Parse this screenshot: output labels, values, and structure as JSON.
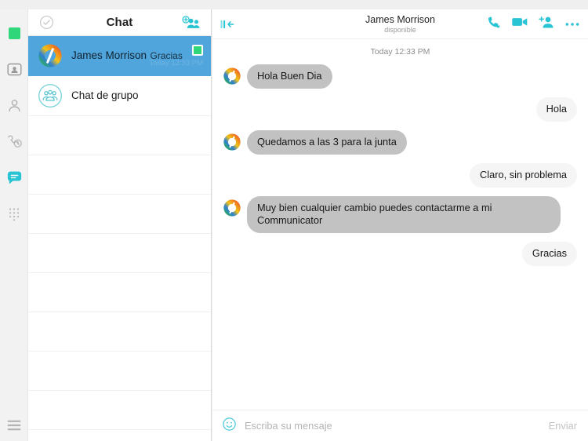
{
  "rail": {
    "items": [
      {
        "name": "presence-status",
        "icon": "green-square-icon",
        "active": false
      },
      {
        "name": "contact-card",
        "icon": "contact-card-icon",
        "active": false
      },
      {
        "name": "person",
        "icon": "person-icon",
        "active": false
      },
      {
        "name": "call-history",
        "icon": "call-history-icon",
        "active": false
      },
      {
        "name": "chat",
        "icon": "chat-bubble-icon",
        "active": true
      },
      {
        "name": "dialpad",
        "icon": "dialpad-icon",
        "active": false
      }
    ],
    "menu_icon": "hamburger-menu-icon"
  },
  "chat_list": {
    "header": {
      "title": "Chat",
      "left_icon": "check-circle-icon",
      "right_icon": "add-group-icon"
    },
    "rows": [
      {
        "name": "James Morrison",
        "preview": "Gracias",
        "time": "Today 12:33 PM",
        "avatar": "logo-ring-avatar",
        "presence": "available",
        "selected": true
      },
      {
        "name": "Chat de grupo",
        "preview": "",
        "time": "",
        "avatar": "group-circle-icon",
        "presence": "",
        "selected": false
      }
    ],
    "empty_row_count": 8
  },
  "conversation": {
    "header": {
      "collapse_icon": "collapse-panel-icon",
      "name": "James Morrison",
      "status": "disponible",
      "actions": [
        {
          "name": "call-button",
          "icon": "phone-icon"
        },
        {
          "name": "video-call-button",
          "icon": "video-camera-icon"
        },
        {
          "name": "add-participant-button",
          "icon": "add-person-icon"
        },
        {
          "name": "more-options-button",
          "icon": "more-dots-icon"
        }
      ]
    },
    "day_separator": "Today 12:33 PM",
    "messages": [
      {
        "direction": "in",
        "text": "Hola Buen Dia"
      },
      {
        "direction": "out",
        "text": "Hola"
      },
      {
        "direction": "in",
        "text": "Quedamos a las 3 para la junta"
      },
      {
        "direction": "out",
        "text": "Claro, sin problema"
      },
      {
        "direction": "in",
        "text": "Muy bien cualquier cambio puedes contactarme a mi Communicator"
      },
      {
        "direction": "out",
        "text": "Gracias"
      }
    ],
    "composer": {
      "emoji_icon": "emoji-smiley-icon",
      "placeholder": "Escriba su mensaje",
      "value": "",
      "send_label": "Enviar"
    }
  },
  "colors": {
    "accent": "#29c4d4",
    "selected_row": "#51a5dd",
    "presence_green": "#2fd67a",
    "bubble_in": "#c2c2c2",
    "bubble_out": "#f5f5f5"
  }
}
